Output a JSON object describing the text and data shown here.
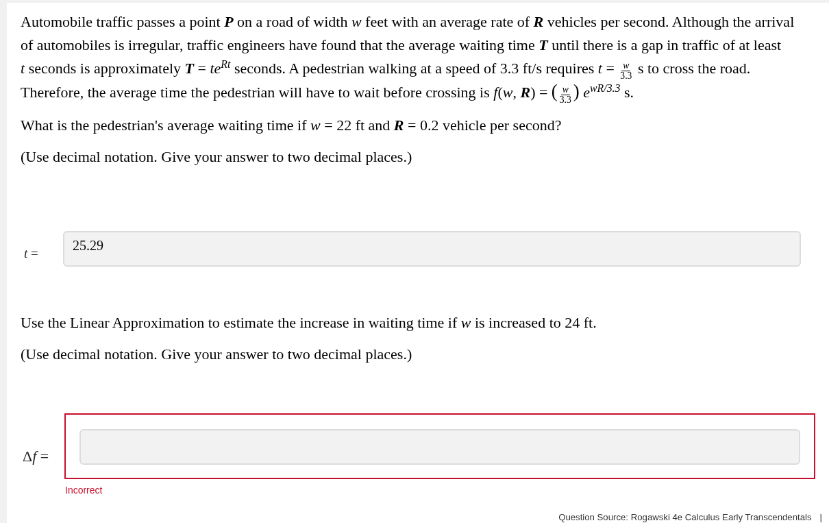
{
  "problem": {
    "parts": [
      {
        "kind": "text",
        "text": "Automobile traffic passes a point **P** on a road of width *w* feet with an average rate of **R** vehicles per second. Although the arrival of automobiles is irregular, traffic engineers have found that the average waiting time **T** until there is a gap in traffic of at least *t* seconds is approximately **T** = *te*$^{Rt}$ seconds. A pedestrian walking at a speed of 3.3 ft/s requires *t* = "
      },
      {
        "kind": "fraction",
        "numerator": "*w*",
        "denominator": "3.3"
      },
      {
        "kind": "text",
        "text": " s to cross the road. Therefore, the average time the pedestrian will have to wait before crossing is *f*(*w*, **R**) = "
      },
      {
        "kind": "fraction",
        "numerator": "*w*",
        "denominator": "3.3",
        "left": "(",
        "right": ")"
      },
      {
        "kind": "text",
        "text": " *e*$^{wR/3.3}$ s."
      }
    ]
  },
  "questions": [
    {
      "question": "What is the pedestrian's average waiting time if *w* = 22 ft and **R** = 0.2 vehicle per second?",
      "instruction": "(Use decimal notation. Give your answer to two decimal places.)",
      "answer": {
        "label": [
          "*t* ="
        ],
        "value": "25.29",
        "incorrect": false
      }
    },
    {
      "question": "Use the Linear Approximation to estimate the increase in waiting time if *w* is increased to 24 ft.",
      "instruction": "(Use decimal notation. Give your answer to two decimal places.)",
      "answer": {
        "label": [
          "Δ",
          "*f* ="
        ],
        "incorrect": true,
        "feedback": "Incorrect"
      }
    }
  ],
  "footer": {
    "source": "Question Source: Rogawski 4e Calculus Early Transcendentals",
    "separator": "|"
  }
}
